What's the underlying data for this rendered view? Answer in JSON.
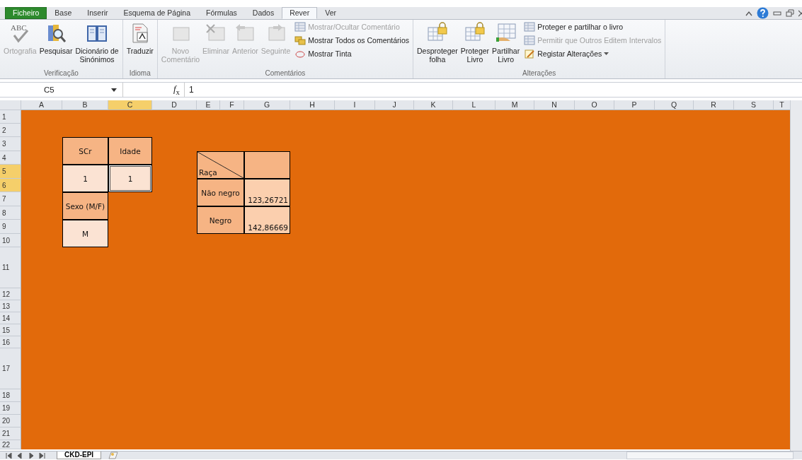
{
  "tabs": [
    {
      "label": "Ficheiro",
      "kind": "file",
      "selected": false
    },
    {
      "label": "Base",
      "kind": "tab",
      "selected": false
    },
    {
      "label": "Inserir",
      "kind": "tab",
      "selected": false
    },
    {
      "label": "Esquema de Página",
      "kind": "tab",
      "selected": false
    },
    {
      "label": "Fórmulas",
      "kind": "tab",
      "selected": false
    },
    {
      "label": "Dados",
      "kind": "tab",
      "selected": false
    },
    {
      "label": "Rever",
      "kind": "tab",
      "selected": true
    },
    {
      "label": "Ver",
      "kind": "tab",
      "selected": false
    }
  ],
  "ribbon": {
    "groups": [
      {
        "label": "Verificação",
        "buttons": [
          {
            "label": "Ortografia",
            "kind": "large",
            "disabled": true,
            "icon_text": "ABC"
          },
          {
            "label": "Pesquisar",
            "kind": "large",
            "disabled": false
          },
          {
            "label": "Dicionário de\nSinónimos",
            "kind": "large",
            "disabled": false
          }
        ]
      },
      {
        "label": "Idioma",
        "buttons": [
          {
            "label": "Traduzir",
            "kind": "large",
            "disabled": false
          }
        ]
      },
      {
        "label": "Comentários",
        "buttons": [
          {
            "label": "Novo\nComentário",
            "kind": "large",
            "disabled": true
          },
          {
            "label": "Eliminar",
            "kind": "large",
            "disabled": true
          },
          {
            "label": "Anterior",
            "kind": "large",
            "disabled": true
          },
          {
            "label": "Seguinte",
            "kind": "large",
            "disabled": true
          },
          {
            "label": "Mostrar/Ocultar Comentário",
            "kind": "small",
            "disabled": true
          },
          {
            "label": "Mostrar Todos os Comentários",
            "kind": "small",
            "disabled": false
          },
          {
            "label": "Mostrar Tinta",
            "kind": "small",
            "disabled": false
          }
        ]
      },
      {
        "label": "Alterações",
        "buttons": [
          {
            "label": "Desproteger\nfolha",
            "kind": "large",
            "disabled": false
          },
          {
            "label": "Proteger\nLivro",
            "kind": "large",
            "disabled": false
          },
          {
            "label": "Partilhar\nLivro",
            "kind": "large",
            "disabled": false
          },
          {
            "label": "Proteger e partilhar o livro",
            "kind": "small",
            "disabled": false
          },
          {
            "label": "Permitir que Outros Editem Intervalos",
            "kind": "small",
            "disabled": true
          },
          {
            "label": "Registar Alterações",
            "kind": "small",
            "disabled": false
          }
        ]
      }
    ]
  },
  "formula_bar": {
    "name_box": "C5",
    "function_button": "*f*$_{x}$",
    "value": "1"
  },
  "columns": [
    {
      "label": "A",
      "selected": false
    },
    {
      "label": "B",
      "selected": false
    },
    {
      "label": "C",
      "selected": true
    },
    {
      "label": "D",
      "selected": false
    },
    {
      "label": "E",
      "selected": false
    },
    {
      "label": "F",
      "selected": false
    },
    {
      "label": "G",
      "selected": false
    },
    {
      "label": "H",
      "selected": false
    },
    {
      "label": "I",
      "selected": false
    },
    {
      "label": "J",
      "selected": false
    },
    {
      "label": "K",
      "selected": false
    },
    {
      "label": "L",
      "selected": false
    },
    {
      "label": "M",
      "selected": false
    },
    {
      "label": "N",
      "selected": false
    },
    {
      "label": "O",
      "selected": false
    },
    {
      "label": "P",
      "selected": false
    },
    {
      "label": "Q",
      "selected": false
    },
    {
      "label": "R",
      "selected": false
    },
    {
      "label": "S",
      "selected": false
    },
    {
      "label": "T",
      "selected": false
    }
  ],
  "rows": [
    {
      "label": "1",
      "selected": false
    },
    {
      "label": "2",
      "selected": false
    },
    {
      "label": "3",
      "selected": false
    },
    {
      "label": "4",
      "selected": false
    },
    {
      "label": "5",
      "selected": true
    },
    {
      "label": "6",
      "selected": true
    },
    {
      "label": "7",
      "selected": false
    },
    {
      "label": "8",
      "selected": false
    },
    {
      "label": "9",
      "selected": false
    },
    {
      "label": "10",
      "selected": false
    },
    {
      "label": "11",
      "selected": false
    },
    {
      "label": "12",
      "selected": false
    },
    {
      "label": "13",
      "selected": false
    },
    {
      "label": "14",
      "selected": false
    },
    {
      "label": "15",
      "selected": false
    },
    {
      "label": "16",
      "selected": false
    },
    {
      "label": "17",
      "selected": false
    },
    {
      "label": "18",
      "selected": false
    },
    {
      "label": "19",
      "selected": false
    },
    {
      "label": "20",
      "selected": false
    },
    {
      "label": "21",
      "selected": false
    },
    {
      "label": "22",
      "selected": false
    }
  ],
  "cells": [
    {
      "text": "SCr",
      "kind": "header",
      "selected": false
    },
    {
      "text": "Idade",
      "kind": "header",
      "selected": false
    },
    {
      "text": "1",
      "kind": "value",
      "selected": false
    },
    {
      "text": "1",
      "kind": "value",
      "selected": true
    },
    {
      "text": "Sexo (M/F)",
      "kind": "header",
      "selected": false
    },
    {
      "text": "M",
      "kind": "value",
      "selected": false
    },
    {
      "text": "Raça",
      "kind": "diagonal",
      "selected": false
    },
    {
      "kind": "header",
      "selected": false
    },
    {
      "text": "Não negro",
      "kind": "header",
      "selected": false
    },
    {
      "text": "123,26721",
      "kind": "number",
      "selected": false
    },
    {
      "text": "Negro",
      "kind": "header",
      "selected": false
    },
    {
      "text": "142,86669",
      "kind": "number",
      "selected": false
    }
  ],
  "sheet_tabs": [
    {
      "label": "CKD-EPI",
      "selected": true
    }
  ]
}
